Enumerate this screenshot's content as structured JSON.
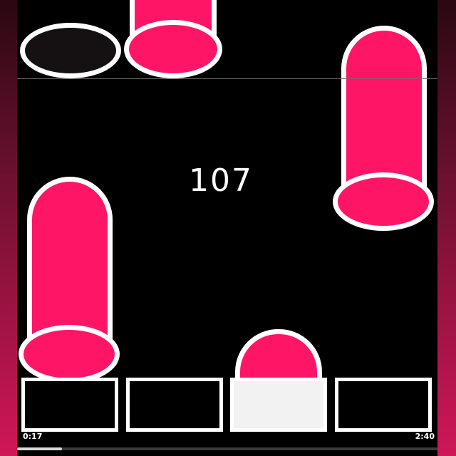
{
  "game": {
    "score": "107",
    "accent_color": "#fe1566",
    "time_elapsed": "0:17",
    "time_total": "2:40",
    "progress_fraction": 0.10625
  },
  "tiles": [
    {
      "lane": 2,
      "state": "hit-target",
      "color": "#fe1566"
    },
    {
      "lane": 1,
      "state": "missed-target",
      "color": "#151011"
    },
    {
      "lane": 4,
      "state": "falling",
      "color": "#fe1566"
    },
    {
      "lane": 1,
      "state": "falling",
      "color": "#fe1566"
    },
    {
      "lane": 3,
      "state": "being-held",
      "color": "#fe1566"
    }
  ],
  "keys": [
    {
      "lane": 1,
      "pressed": false
    },
    {
      "lane": 2,
      "pressed": false
    },
    {
      "lane": 3,
      "pressed": true
    },
    {
      "lane": 4,
      "pressed": false
    }
  ]
}
